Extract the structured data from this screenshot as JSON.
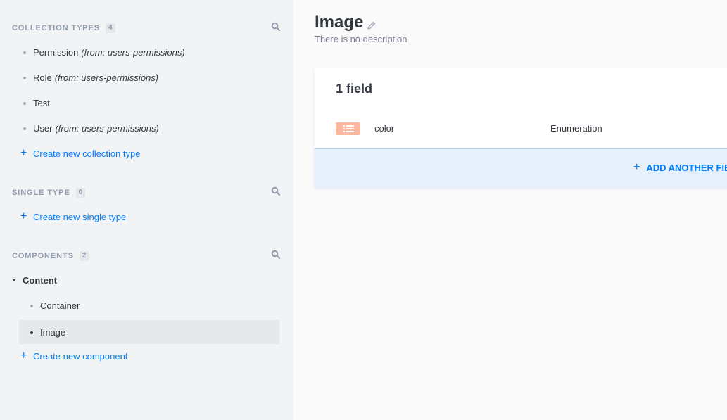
{
  "sidebar": {
    "collection_types": {
      "title": "Collection Types",
      "count": "4",
      "items": [
        {
          "name": "Permission",
          "plugin": "(from: users-permissions)"
        },
        {
          "name": "Role",
          "plugin": "(from: users-permissions)"
        },
        {
          "name": "Test",
          "plugin": ""
        },
        {
          "name": "User",
          "plugin": "(from: users-permissions)"
        }
      ],
      "create_label": "Create new collection type"
    },
    "single_types": {
      "title": "Single Type",
      "count": "0",
      "create_label": "Create new single type"
    },
    "components": {
      "title": "Components",
      "count": "2",
      "category": "Content",
      "items": [
        {
          "name": "Container"
        },
        {
          "name": "Image"
        }
      ],
      "active_item": "Image",
      "create_label": "Create new component"
    }
  },
  "main": {
    "title": "Image",
    "description": "There is no description",
    "card": {
      "fields_count_label": "1 field",
      "fields": [
        {
          "name": "color",
          "type": "Enumeration",
          "icon": "list-icon"
        }
      ],
      "add_button_label": "ADD ANOTHER FIELD"
    }
  },
  "colors": {
    "accent": "#007eff",
    "sidebar_bg": "#f2f3f4",
    "enum_icon_bg": "#fab8a1"
  }
}
